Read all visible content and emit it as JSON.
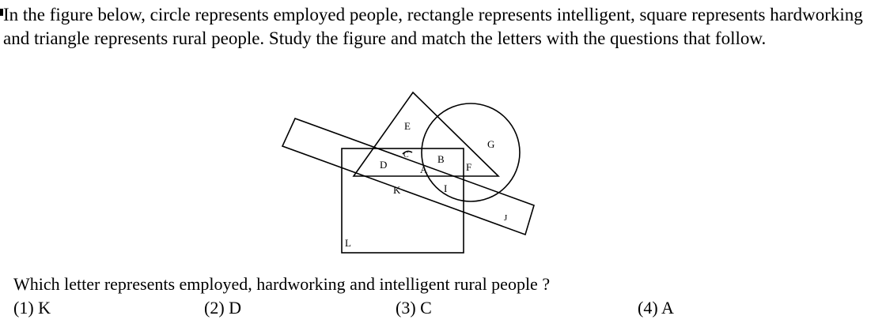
{
  "problem": {
    "stem": "In the figure below, circle represents employed people, rectangle represents intelligent, square represents hardworking and triangle represents rural people. Study the figure and match the letters with the questions that follow.",
    "question": "Which letter represents employed, hardworking and intelligent rural people ?",
    "options": [
      "(1) K",
      "(2) D",
      "(3) C",
      "(4) A"
    ]
  },
  "figure": {
    "labels": {
      "A": "A",
      "B": "B",
      "C": "C",
      "D": "D",
      "E": "E",
      "F": "F",
      "G": "G",
      "I": "I",
      "J": "J",
      "K": "K",
      "L": "L"
    }
  }
}
